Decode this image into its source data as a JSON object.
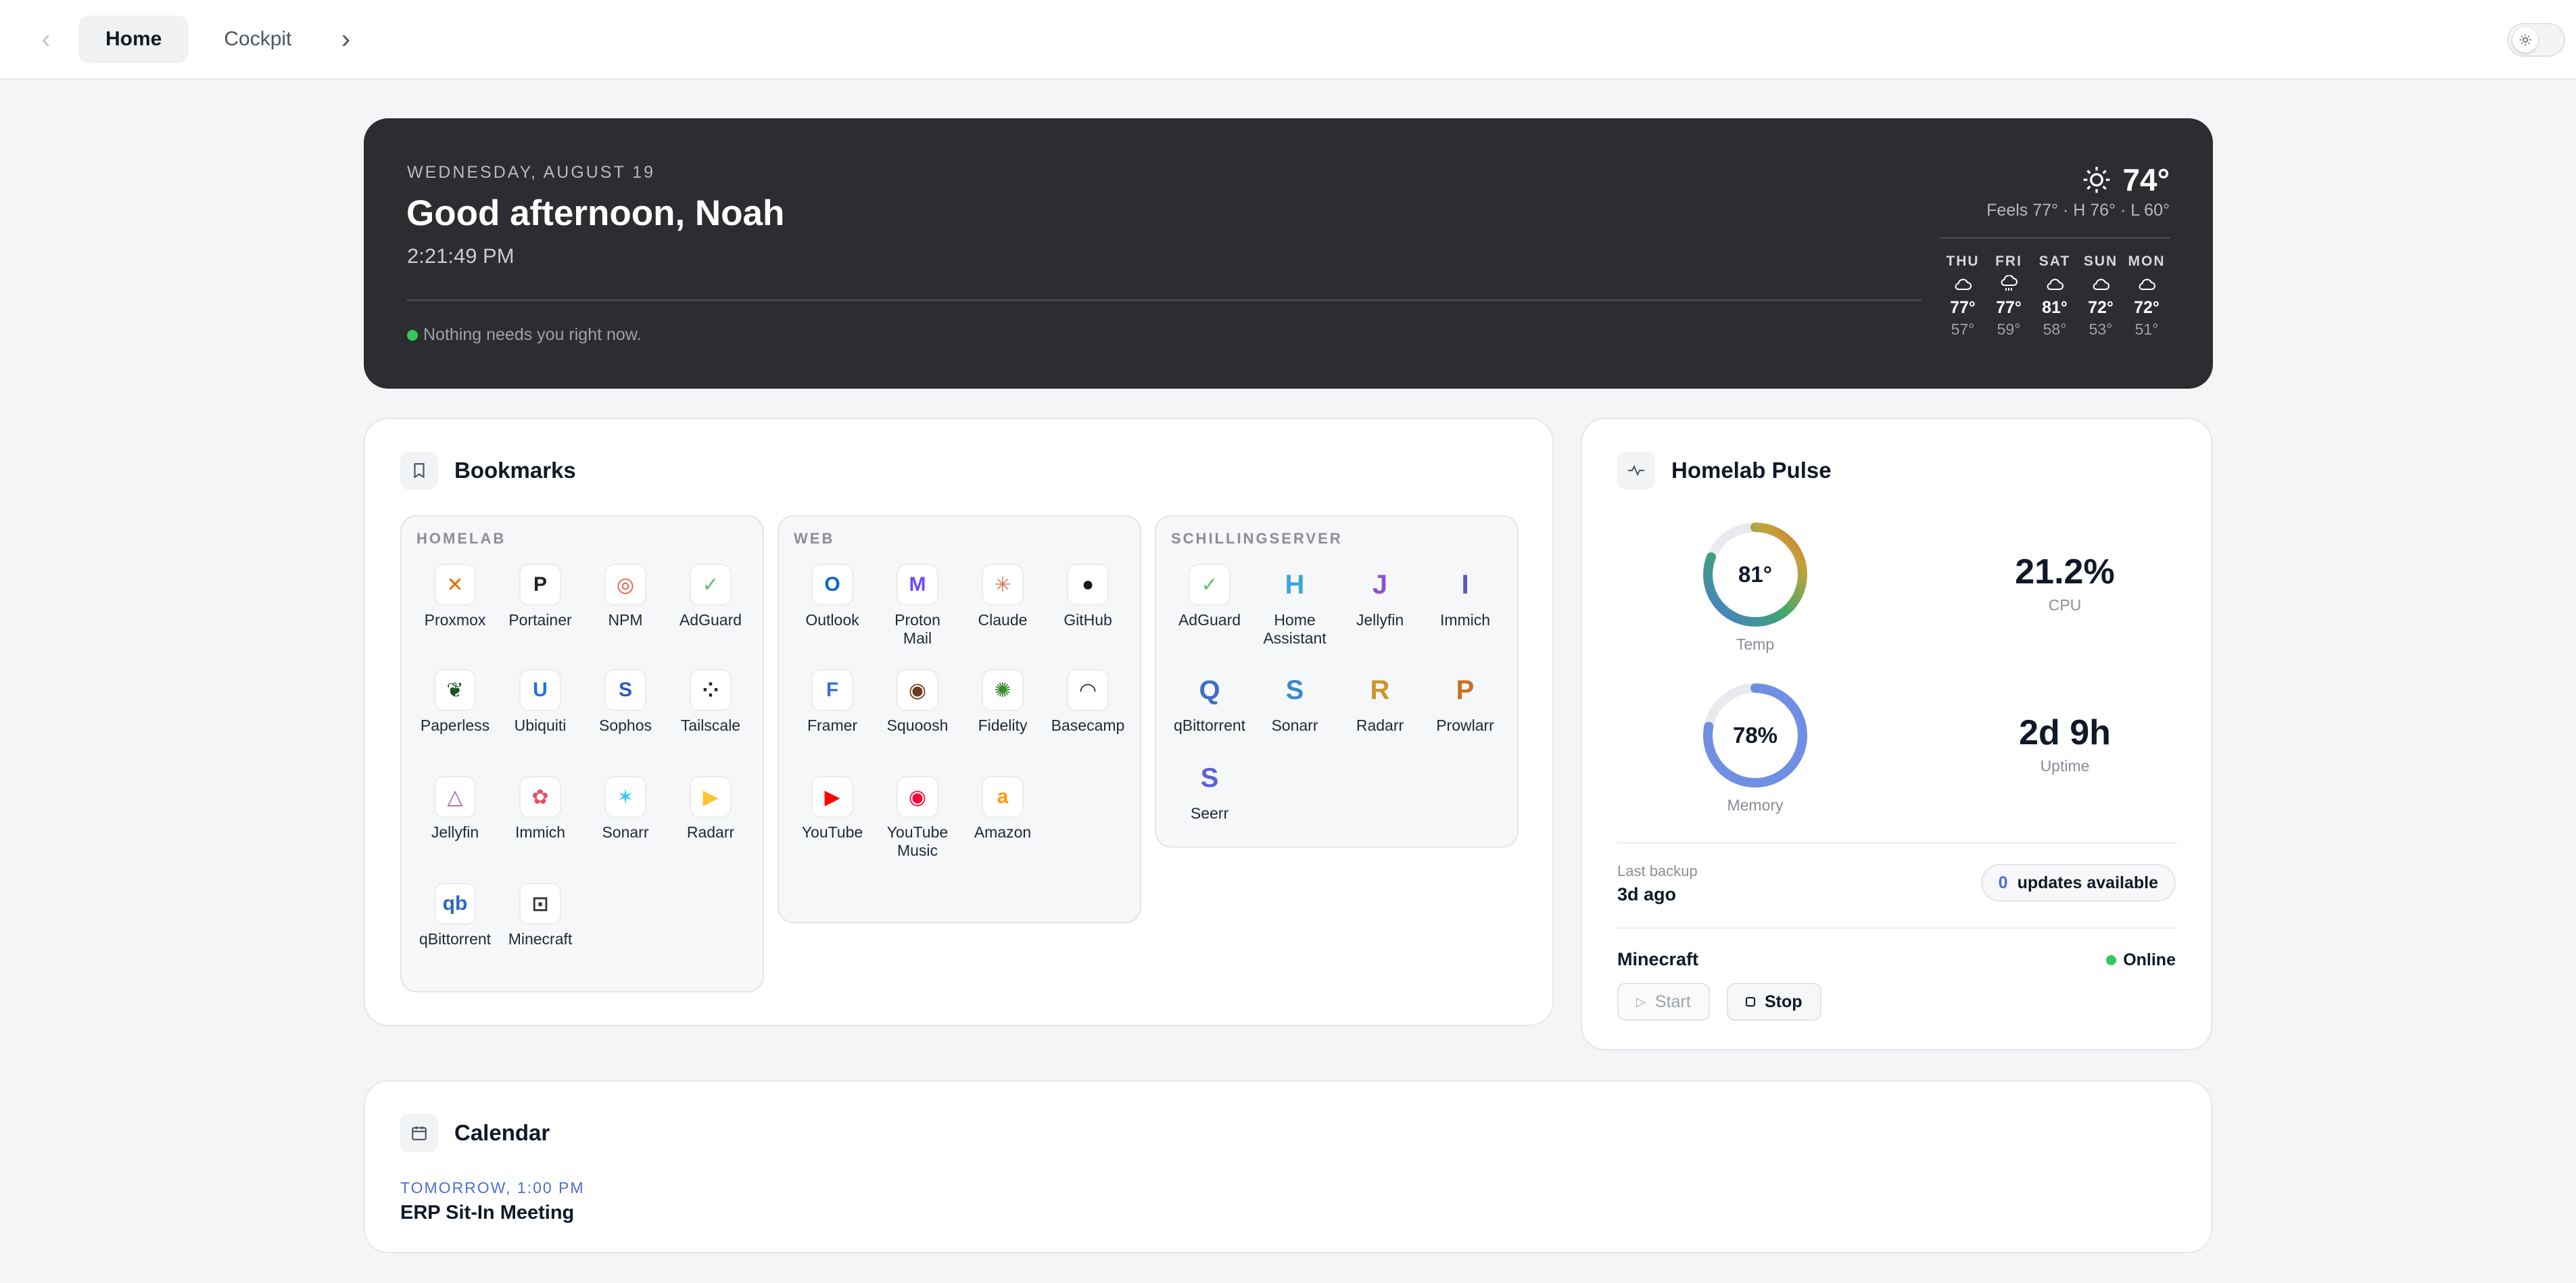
{
  "nav": {
    "back": "‹",
    "forward": "›",
    "tabs": [
      {
        "label": "Home",
        "active": true
      },
      {
        "label": "Cockpit",
        "active": false
      }
    ]
  },
  "hero": {
    "date": "WEDNESDAY, AUGUST 19",
    "greeting": "Good afternoon, Noah",
    "time": "2:21:49 PM",
    "status": "Nothing needs you right now.",
    "weather": {
      "temp": "74°",
      "icon": "sun-icon",
      "details": "Feels 77° · H 76° · L 60°",
      "forecast": [
        {
          "day": "THU",
          "icon": "cloud-icon",
          "high": "77°",
          "low": "57°"
        },
        {
          "day": "FRI",
          "icon": "cloud-rain-icon",
          "high": "77°",
          "low": "59°"
        },
        {
          "day": "SAT",
          "icon": "cloud-icon",
          "high": "81°",
          "low": "58°"
        },
        {
          "day": "SUN",
          "icon": "cloud-icon",
          "high": "72°",
          "low": "53°"
        },
        {
          "day": "MON",
          "icon": "cloud-icon",
          "high": "72°",
          "low": "51°"
        }
      ]
    }
  },
  "bookmarks": {
    "title": "Bookmarks",
    "groups": [
      {
        "title": "HOMELAB",
        "items": [
          {
            "label": "Proxmox",
            "glyph": "✕",
            "color": "#e57000"
          },
          {
            "label": "Portainer",
            "glyph": "P",
            "color": "#222222"
          },
          {
            "label": "NPM",
            "glyph": "◎",
            "color": "#f15833"
          },
          {
            "label": "AdGuard",
            "glyph": "✓",
            "color": "#68bc71"
          },
          {
            "label": "Paperless",
            "glyph": "❦",
            "color": "#17541f"
          },
          {
            "label": "Ubiquiti",
            "glyph": "U",
            "color": "#1f6feb"
          },
          {
            "label": "Sophos",
            "glyph": "S",
            "color": "#2b5ab8"
          },
          {
            "label": "Tailscale",
            "glyph": "⁘",
            "color": "#242424"
          },
          {
            "label": "Jellyfin",
            "glyph": "△",
            "color": "#aa5cc3"
          },
          {
            "label": "Immich",
            "glyph": "✿",
            "color": "#e94f64"
          },
          {
            "label": "Sonarr",
            "glyph": "✶",
            "color": "#35c5f4"
          },
          {
            "label": "Radarr",
            "glyph": "▶",
            "color": "#ffc230"
          },
          {
            "label": "qBittorrent",
            "glyph": "qb",
            "color": "#2f67ba"
          },
          {
            "label": "Minecraft",
            "glyph": "⊡",
            "color": "#3a3a3a"
          }
        ]
      },
      {
        "title": "WEB",
        "items": [
          {
            "label": "Outlook",
            "glyph": "O",
            "color": "#0a64c9"
          },
          {
            "label": "Proton Mail",
            "glyph": "M",
            "color": "#6d4aff"
          },
          {
            "label": "Claude",
            "glyph": "✳",
            "color": "#d97757"
          },
          {
            "label": "GitHub",
            "glyph": "●",
            "color": "#181717"
          },
          {
            "label": "Framer",
            "glyph": "F",
            "color": "#3b6fd8"
          },
          {
            "label": "Squoosh",
            "glyph": "◉",
            "color": "#6d3b1e"
          },
          {
            "label": "Fidelity",
            "glyph": "✺",
            "color": "#3b8a2f"
          },
          {
            "label": "Basecamp",
            "glyph": "◠",
            "color": "#1d2d35"
          },
          {
            "label": "YouTube",
            "glyph": "▶",
            "color": "#ff0000"
          },
          {
            "label": "YouTube Music",
            "glyph": "◉",
            "color": "#ff0033"
          },
          {
            "label": "Amazon",
            "glyph": "a",
            "color": "#ff9900"
          }
        ]
      },
      {
        "title": "SCHILLINGSERVER",
        "items": [
          {
            "label": "AdGuard",
            "glyph": "✓",
            "color": "#68bc71"
          },
          {
            "label": "Home Assistant",
            "glyph": "H",
            "color": "#3ba6dd"
          },
          {
            "label": "Jellyfin",
            "glyph": "J",
            "color": "#8f4fd1"
          },
          {
            "label": "Immich",
            "glyph": "I",
            "color": "#5b54c9"
          },
          {
            "label": "qBittorrent",
            "glyph": "Q",
            "color": "#3f6fc4"
          },
          {
            "label": "Sonarr",
            "glyph": "S",
            "color": "#3c8ac9"
          },
          {
            "label": "Radarr",
            "glyph": "R",
            "color": "#c9962b"
          },
          {
            "label": "Prowlarr",
            "glyph": "P",
            "color": "#c9701f"
          },
          {
            "label": "Seerr",
            "glyph": "S",
            "color": "#5a62d6"
          }
        ]
      }
    ]
  },
  "pulse": {
    "title": "Homelab Pulse",
    "temp": {
      "value": "81°",
      "label": "Temp",
      "fraction": 0.81
    },
    "memory": {
      "value": "78%",
      "label": "Memory",
      "fraction": 0.78
    },
    "cpu": {
      "value": "21.2%",
      "label": "CPU"
    },
    "uptime": {
      "value": "2d 9h",
      "label": "Uptime"
    },
    "backup": {
      "label": "Last backup",
      "value": "3d ago"
    },
    "updates": {
      "count": "0",
      "label": "updates available"
    },
    "minecraft": {
      "title": "Minecraft",
      "status": "Online",
      "start": "Start",
      "stop": "Stop"
    }
  },
  "calendar": {
    "title": "Calendar",
    "event_when": "TOMORROW, 1:00 PM",
    "event_title": "ERP Sit-In Meeting"
  },
  "colors": {
    "accent": "#4a6fd8",
    "online": "#34c75a",
    "hero_bg": "#2c2d30"
  }
}
